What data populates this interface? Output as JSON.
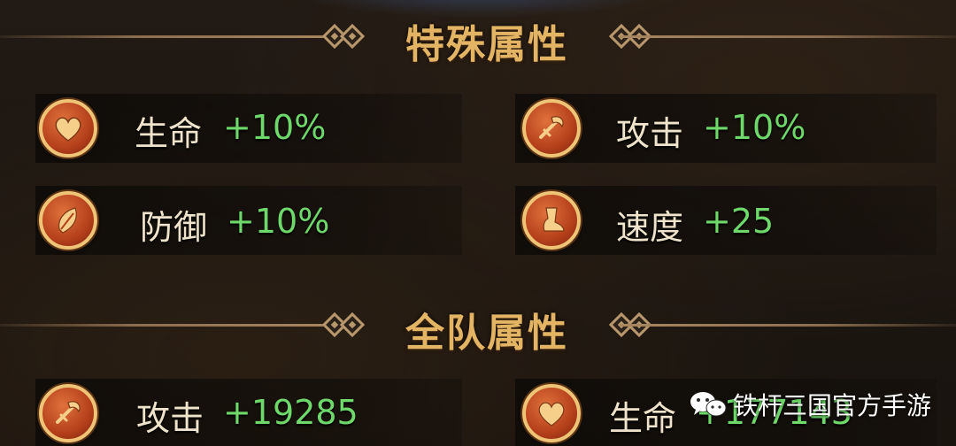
{
  "sections": [
    {
      "title": "特殊属性",
      "stats": [
        {
          "label": "生命",
          "value": "+10%",
          "icon": "heart-icon"
        },
        {
          "label": "攻击",
          "value": "+10%",
          "icon": "axe-icon"
        },
        {
          "label": "防御",
          "value": "+10%",
          "icon": "shield-icon"
        },
        {
          "label": "速度",
          "value": "+25",
          "icon": "boot-icon"
        }
      ]
    },
    {
      "title": "全队属性",
      "stats": [
        {
          "label": "攻击",
          "value": "+19285",
          "icon": "axe-icon"
        },
        {
          "label": "生命",
          "value": "+177143",
          "icon": "heart-icon"
        }
      ]
    }
  ],
  "watermark": {
    "text": "铁杆三国官方手游",
    "icon": "wechat-icon"
  },
  "colors": {
    "title": "#e2b463",
    "label": "#efe3cc",
    "value": "#6fd86a",
    "icon_bg": "#c24a1f",
    "icon_ring": "#f0c477"
  }
}
